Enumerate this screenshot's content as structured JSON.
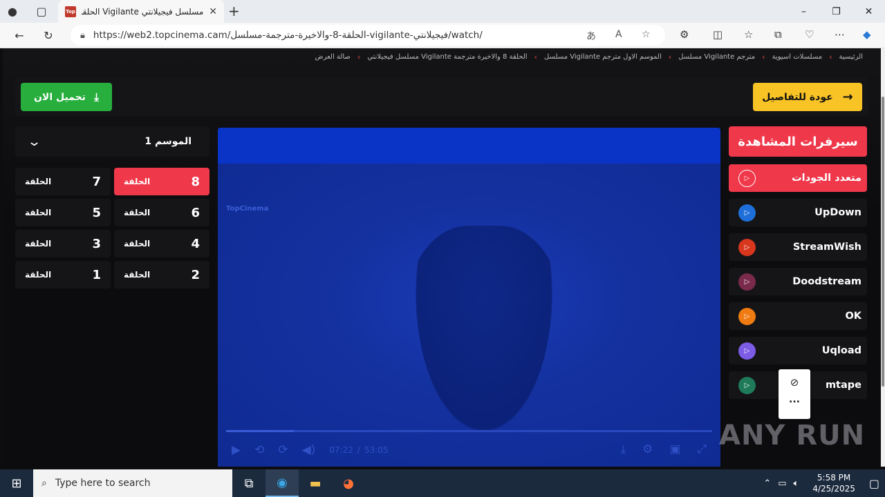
{
  "browser": {
    "tab_title": "مسلسل فيجيلانتي Vigilante الحلقة",
    "tab_favicon_text": "Top",
    "url": "https://web2.topcinema.cam/الحلقة-8-والاخيرة-مترجمة-مسلسل-vigilante-فيجيلانتي/watch/",
    "new_tab": "+",
    "minimize": "–",
    "maximize": "❐",
    "close": "✕"
  },
  "breadcrumb": [
    "الرئيسية",
    "مسلسلات اسيوية",
    "مسلسل Vigilante مترجم",
    "مسلسل Vigilante الموسم الاول مترجم",
    "مسلسل فيجيلانتي Vigilante الحلقة 8 والاخيرة مترجمة",
    "صالة العرض"
  ],
  "buttons": {
    "back_details": "عودة للتفاصيل",
    "download_now": "تحميل الان"
  },
  "season": {
    "title": "الموسم 1"
  },
  "episodes": [
    {
      "label": "الحلقة",
      "num": "8",
      "active": true
    },
    {
      "label": "الحلقة",
      "num": "7",
      "active": false
    },
    {
      "label": "الحلقة",
      "num": "6",
      "active": false
    },
    {
      "label": "الحلقة",
      "num": "5",
      "active": false
    },
    {
      "label": "الحلقة",
      "num": "4",
      "active": false
    },
    {
      "label": "الحلقة",
      "num": "3",
      "active": false
    },
    {
      "label": "الحلقة",
      "num": "2",
      "active": false
    },
    {
      "label": "الحلقة",
      "num": "1",
      "active": false
    }
  ],
  "player": {
    "watermark": "TopCinema",
    "current_time": "07:22",
    "time_sep": "/",
    "duration": "53:05",
    "progress": 0.139
  },
  "servers": {
    "title": "سيرفرات المشاهدة",
    "items": [
      {
        "name": "متعدد الجودات",
        "color": "#f0384b",
        "active": true
      },
      {
        "name": "UpDown",
        "color": "#1e6fd9",
        "active": false
      },
      {
        "name": "StreamWish",
        "color": "#d9361e",
        "active": false
      },
      {
        "name": "Doodstream",
        "color": "#7a2a4a",
        "active": false
      },
      {
        "name": "OK",
        "color": "#f07b12",
        "active": false
      },
      {
        "name": "Uqload",
        "color": "#7c5ce6",
        "active": false
      },
      {
        "name": "mtape",
        "color": "#1f7a5a",
        "active": false
      }
    ]
  },
  "popup": {
    "more": "..."
  },
  "watermark": "ANY RUN",
  "taskbar": {
    "search_placeholder": "Type here to search",
    "time": "5:58 PM",
    "date": "4/25/2025"
  },
  "colors": {
    "accent_red": "#f0384b",
    "accent_yellow": "#f7c325",
    "accent_green": "#27ae3d",
    "player_blue": "#0e2fb0"
  }
}
